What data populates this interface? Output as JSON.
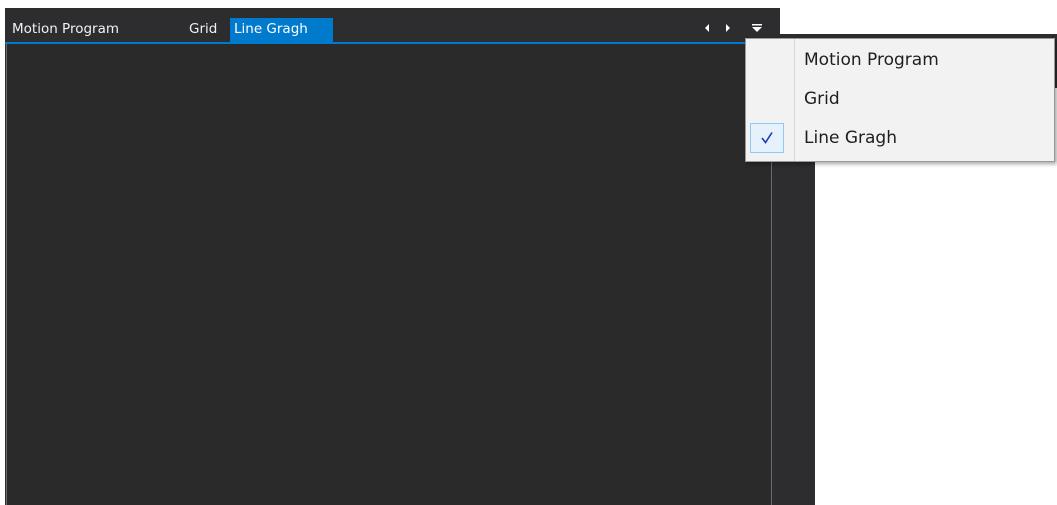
{
  "tabs": [
    {
      "label": "Motion Program",
      "active": false
    },
    {
      "label": "Grid",
      "active": false
    },
    {
      "label": "Line Gragh",
      "active": true
    }
  ],
  "nav": {
    "prev_icon": "caret-left-icon",
    "next_icon": "caret-right-icon",
    "menu_icon": "caret-down-icon"
  },
  "menu": {
    "items": [
      {
        "label": "Motion Program",
        "checked": false
      },
      {
        "label": "Grid",
        "checked": false
      },
      {
        "label": "Line Gragh",
        "checked": true
      }
    ],
    "check_icon": "checkmark-icon"
  },
  "colors": {
    "panel_bg": "#2d2d30",
    "content_bg": "#2a2a2a",
    "accent": "#007acc",
    "menu_bg": "#f2f2f2",
    "check_bg": "#e5f1fb",
    "check_fg": "#1c39bb"
  }
}
